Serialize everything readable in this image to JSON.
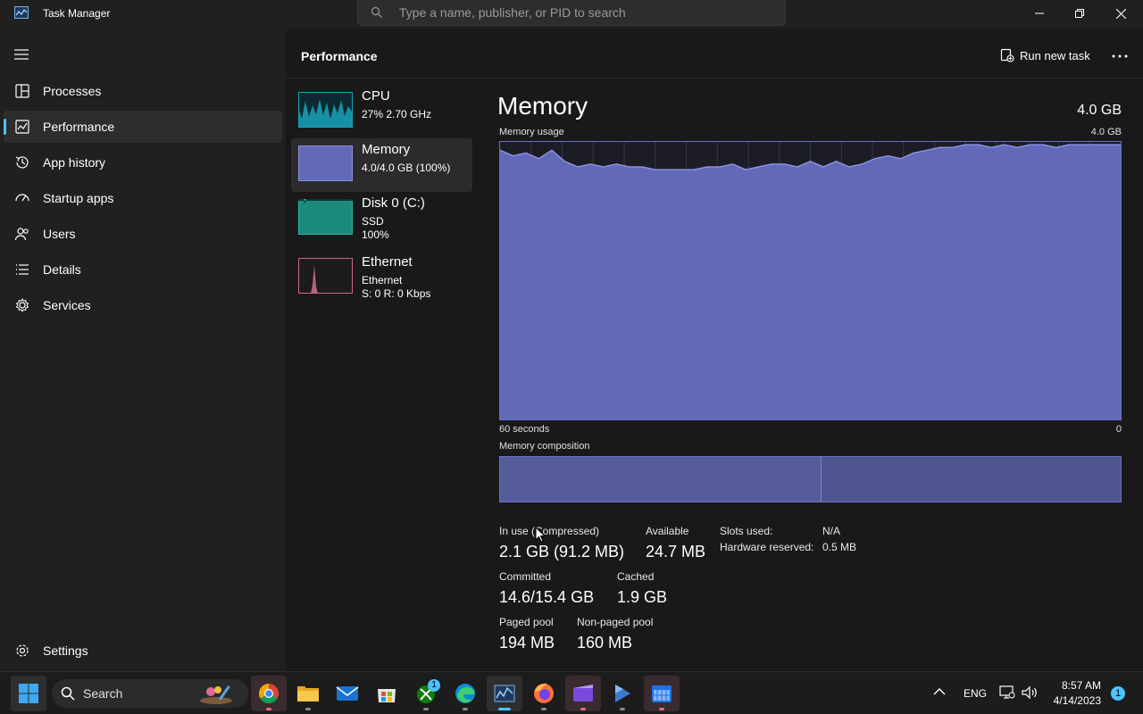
{
  "window": {
    "title": "Task Manager",
    "search_placeholder": "Type a name, publisher, or PID to search"
  },
  "nav": {
    "items": [
      {
        "label": "Processes",
        "icon": "processes-icon"
      },
      {
        "label": "Performance",
        "icon": "performance-icon",
        "active": true
      },
      {
        "label": "App history",
        "icon": "history-icon"
      },
      {
        "label": "Startup apps",
        "icon": "startup-icon"
      },
      {
        "label": "Users",
        "icon": "users-icon"
      },
      {
        "label": "Details",
        "icon": "details-icon"
      },
      {
        "label": "Services",
        "icon": "services-icon"
      }
    ],
    "settings_label": "Settings"
  },
  "header": {
    "title": "Performance",
    "run_task_label": "Run new task"
  },
  "resources": [
    {
      "name": "CPU",
      "sub1": "27%  2.70 GHz",
      "sub2": "",
      "color": "#17a2b8"
    },
    {
      "name": "Memory",
      "sub1": "4.0/4.0 GB (100%)",
      "sub2": "",
      "color": "#6770c7",
      "active": true
    },
    {
      "name": "Disk 0 (C:)",
      "sub1": "SSD",
      "sub2": "100%",
      "color": "#1b8a7a"
    },
    {
      "name": "Ethernet",
      "sub1": "Ethernet",
      "sub2": "S: 0 R: 0 Kbps",
      "color": "#c96a8f"
    }
  ],
  "memory": {
    "title": "Memory",
    "total": "4.0 GB",
    "usage_label": "Memory usage",
    "usage_max": "4.0 GB",
    "time_left": "60 seconds",
    "time_right": "0",
    "composition_label": "Memory composition",
    "usage_history_percent": [
      97,
      95,
      96,
      94,
      97,
      93,
      91,
      92,
      91,
      92,
      91,
      91,
      90,
      90,
      90,
      90,
      91,
      91,
      92,
      90,
      91,
      92,
      92,
      91,
      93,
      91,
      93,
      91,
      92,
      94,
      95,
      94,
      96,
      97,
      98,
      98,
      99,
      99,
      98,
      99,
      98,
      99,
      99,
      98,
      99,
      99,
      99,
      99,
      99
    ],
    "colors": {
      "accent": "#6770c7",
      "fill": "#6169b8"
    }
  },
  "stats": {
    "in_use_label": "In use (Compressed)",
    "in_use_value": "2.1 GB (91.2 MB)",
    "available_label": "Available",
    "available_value": "24.7 MB",
    "slots_label": "Slots used:",
    "slots_value": "N/A",
    "hw_reserved_label": "Hardware reserved:",
    "hw_reserved_value": "0.5 MB",
    "committed_label": "Committed",
    "committed_value": "14.6/15.4 GB",
    "cached_label": "Cached",
    "cached_value": "1.9 GB",
    "paged_label": "Paged pool",
    "paged_value": "194 MB",
    "nonpaged_label": "Non-paged pool",
    "nonpaged_value": "160 MB"
  },
  "taskbar": {
    "search_label": "Search",
    "mail_badge": "1",
    "lang": "ENG",
    "time": "8:57 AM",
    "date": "4/14/2023",
    "notification_count": "1"
  }
}
